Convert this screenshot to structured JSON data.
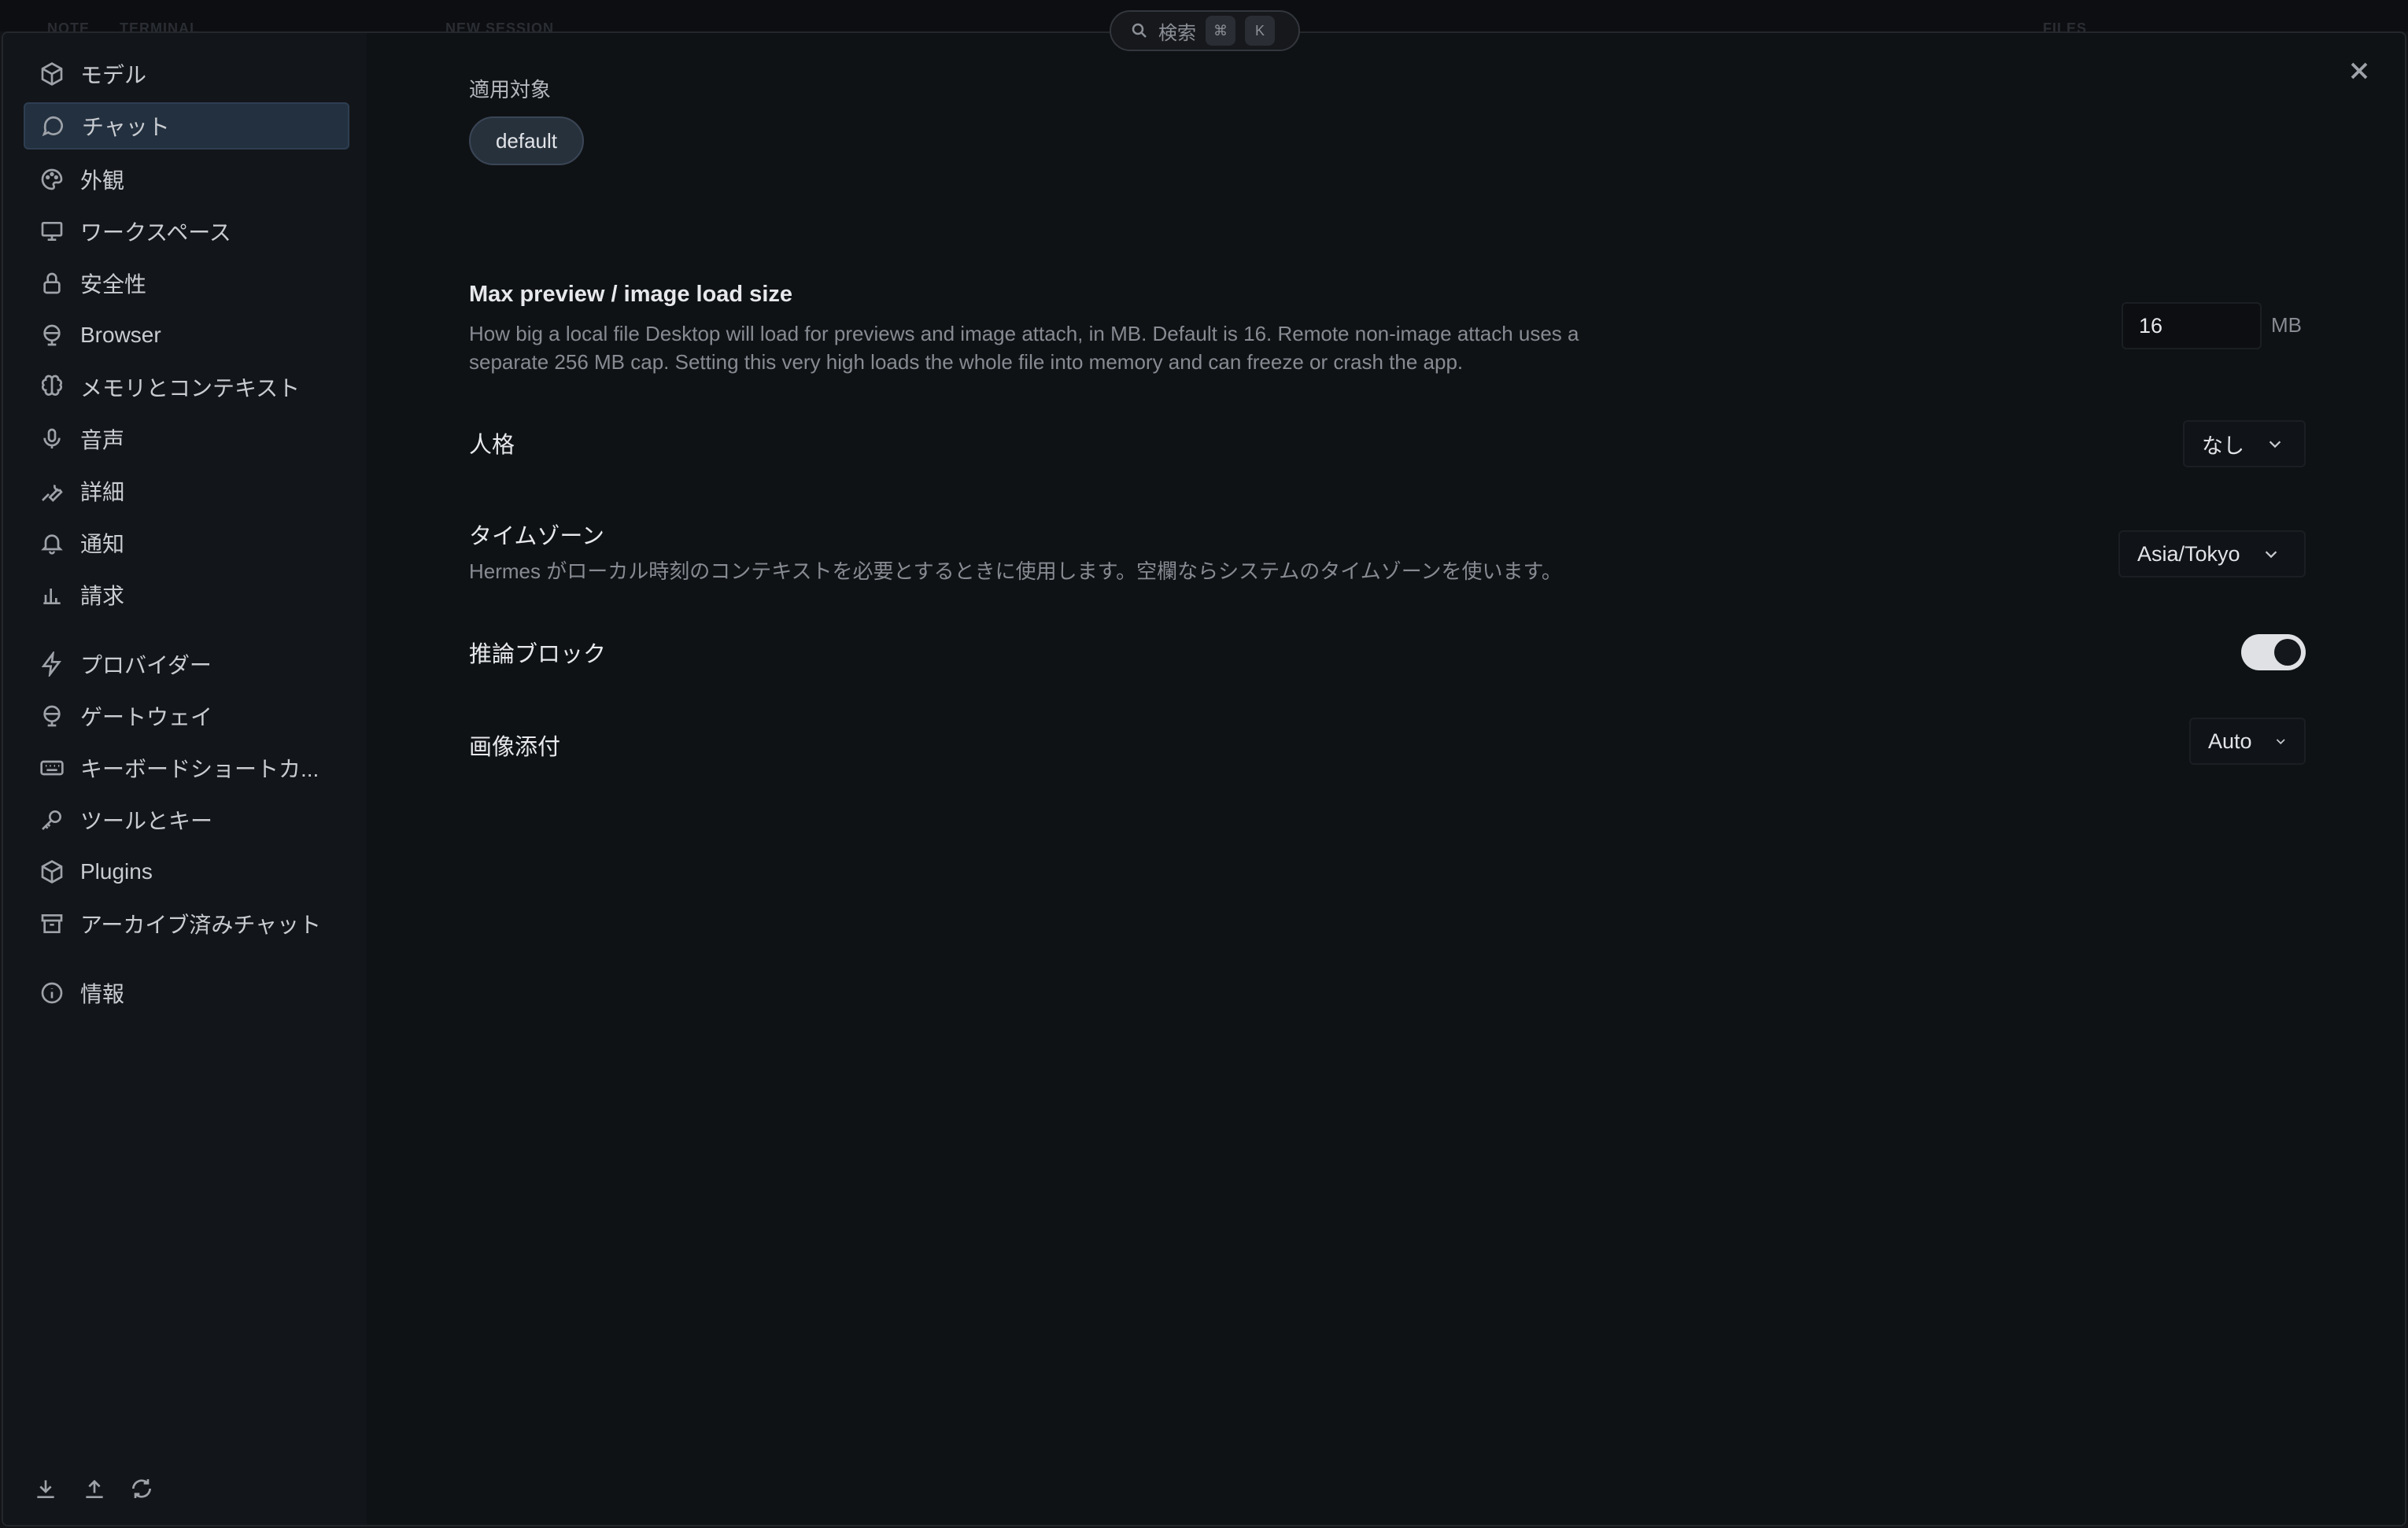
{
  "bg_tabs": [
    "NOTE",
    "TERMINAL",
    "NEW SESSION",
    "FILES"
  ],
  "search": {
    "label": "検索",
    "key1": "⌘",
    "key2": "K"
  },
  "sidebar": {
    "items": [
      {
        "label": "モデル",
        "icon": "cube-icon"
      },
      {
        "label": "チャット",
        "icon": "chat-bubble-icon",
        "active": true
      },
      {
        "label": "外観",
        "icon": "palette-icon"
      },
      {
        "label": "ワークスペース",
        "icon": "monitor-icon"
      },
      {
        "label": "安全性",
        "icon": "lock-icon"
      },
      {
        "label": "Browser",
        "icon": "globe-icon"
      },
      {
        "label": "メモリとコンテキスト",
        "icon": "brain-icon"
      },
      {
        "label": "音声",
        "icon": "microphone-icon"
      },
      {
        "label": "詳細",
        "icon": "wrench-icon"
      },
      {
        "label": "通知",
        "icon": "bell-icon"
      },
      {
        "label": "請求",
        "icon": "bar-chart-icon"
      },
      {
        "label": "プロバイダー",
        "icon": "lightning-icon"
      },
      {
        "label": "ゲートウェイ",
        "icon": "globe-icon"
      },
      {
        "label": "キーボードショートカ...",
        "icon": "keyboard-icon"
      },
      {
        "label": "ツールとキー",
        "icon": "key-icon"
      },
      {
        "label": "Plugins",
        "icon": "package-icon"
      },
      {
        "label": "アーカイブ済みチャット",
        "icon": "archive-icon"
      },
      {
        "label": "情報",
        "icon": "info-icon"
      }
    ]
  },
  "main": {
    "scope_label": "適用対象",
    "scope_chip": "default",
    "max_preview": {
      "title": "Max preview / image load size",
      "desc_line1": "How big a local file Desktop will load for previews and image attach, in MB. Default is 16. Remote non-image attach uses a",
      "desc_line2": "separate 256 MB cap. Setting this very high loads the whole file into memory and can freeze or crash the app.",
      "value": "16",
      "unit": "MB"
    },
    "personality": {
      "title": "人格",
      "value": "なし"
    },
    "timezone": {
      "title": "タイムゾーン",
      "desc": "Hermes がローカル時刻のコンテキストを必要とするときに使用します。空欄ならシステムのタイムゾーンを使います。",
      "value": "Asia/Tokyo"
    },
    "reasoning": {
      "title": "推論ブロック",
      "enabled": true
    },
    "image_attach": {
      "title": "画像添付",
      "value": "Auto"
    }
  }
}
